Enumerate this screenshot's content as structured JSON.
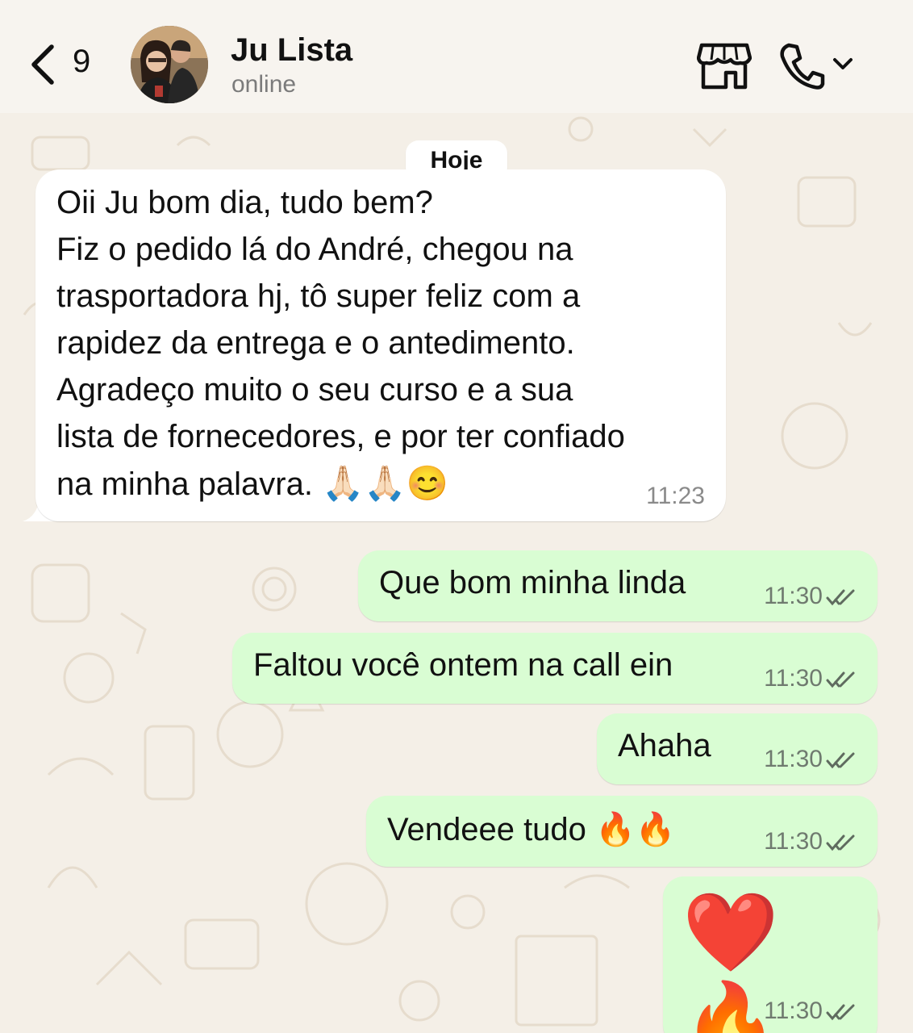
{
  "header": {
    "back_count": "9",
    "contact_name": "Ju Lista",
    "contact_status": "online"
  },
  "chat": {
    "date_label": "Hoje",
    "incoming": {
      "lines": [
        "Oii Ju bom dia, tudo bem?",
        "Fiz o pedido lá do André, chegou na",
        "trasportadora hj, tô super feliz com a",
        "rapidez da entrega e o antedimento.",
        "Agradeço muito o seu curso e a sua",
        "lista de fornecedores, e por ter confiado",
        "na minha palavra."
      ],
      "trailing_emojis": "🙏🏻🙏🏻😊",
      "time": "11:23"
    },
    "outgoing": [
      {
        "text": "Que bom minha linda",
        "time": "11:30"
      },
      {
        "text": "Faltou você ontem na call ein",
        "time": "11:30"
      },
      {
        "text": "Ahaha",
        "time": "11:30"
      },
      {
        "text": "Vendeee tudo 🔥🔥",
        "time": "11:30"
      },
      {
        "text": "❤️ 🔥",
        "time": "11:30"
      }
    ]
  },
  "icons": {
    "back": "chevron-left-icon",
    "store": "store-icon",
    "call": "phone-icon",
    "dropdown": "chevron-down-icon",
    "read_status": "double-check-icon"
  },
  "colors": {
    "outgoing_bubble": "#d9fdd3",
    "incoming_bubble": "#ffffff",
    "wallpaper": "#f4efe7",
    "read_ticks": "#5f6b5f"
  }
}
